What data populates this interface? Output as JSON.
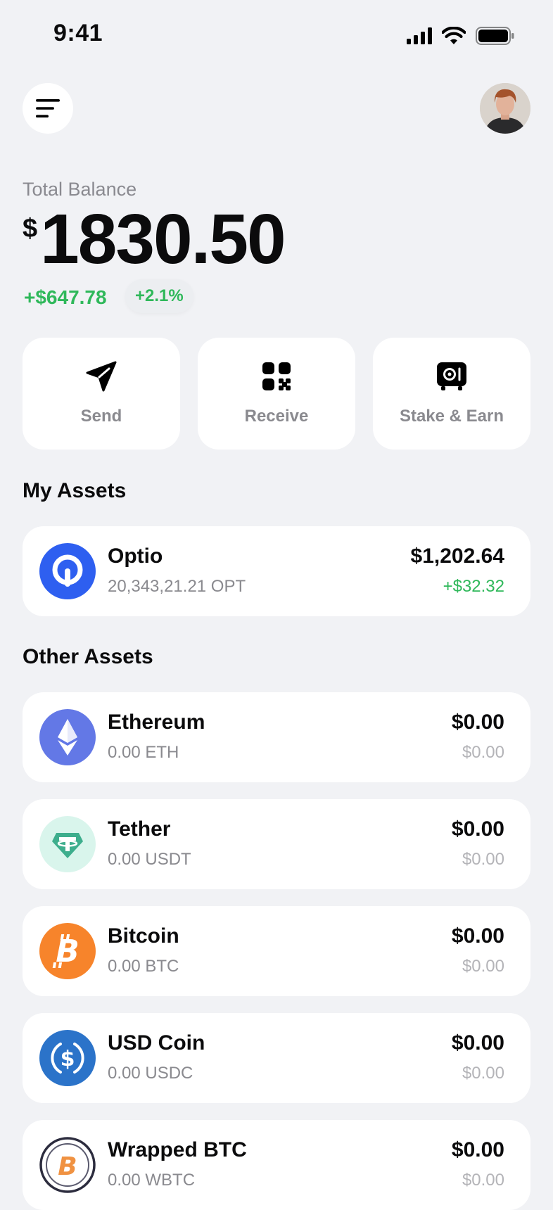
{
  "status_bar": {
    "time": "9:41"
  },
  "balance": {
    "label": "Total Balance",
    "currency": "$",
    "amount": "1830.50",
    "change": "+$647.78",
    "change_pct": "+2.1%"
  },
  "actions": [
    {
      "label": "Send",
      "icon": "send-icon"
    },
    {
      "label": "Receive",
      "icon": "qr-code-icon"
    },
    {
      "label": "Stake & Earn",
      "icon": "vault-icon"
    }
  ],
  "my_assets": {
    "title": "My Assets",
    "items": [
      {
        "name": "Optio",
        "amount": "20,343,21.21 OPT",
        "value": "$1,202.64",
        "change": "+$32.32",
        "icon": "optio-icon",
        "color": "#2e5ff0"
      }
    ]
  },
  "other_assets": {
    "title": "Other Assets",
    "items": [
      {
        "name": "Ethereum",
        "amount": "0.00 ETH",
        "value": "$0.00",
        "change": "$0.00",
        "icon": "ethereum-icon",
        "color": "#6378e6"
      },
      {
        "name": "Tether",
        "amount": "0.00 USDT",
        "value": "$0.00",
        "change": "$0.00",
        "icon": "tether-icon",
        "color": "#d9f5ec"
      },
      {
        "name": "Bitcoin",
        "amount": "0.00 BTC",
        "value": "$0.00",
        "change": "$0.00",
        "icon": "bitcoin-icon",
        "color": "#f7842b"
      },
      {
        "name": "USD Coin",
        "amount": "0.00 USDC",
        "value": "$0.00",
        "change": "$0.00",
        "icon": "usd-coin-icon",
        "color": "#2b73c9"
      },
      {
        "name": "Wrapped BTC",
        "amount": "0.00 WBTC",
        "value": "$0.00",
        "change": "$0.00",
        "icon": "wrapped-btc-icon",
        "color": "#ffffff"
      }
    ]
  },
  "colors": {
    "positive": "#2fb85a",
    "background": "#f1f2f5",
    "card": "#ffffff",
    "muted": "#8a8a8f"
  }
}
